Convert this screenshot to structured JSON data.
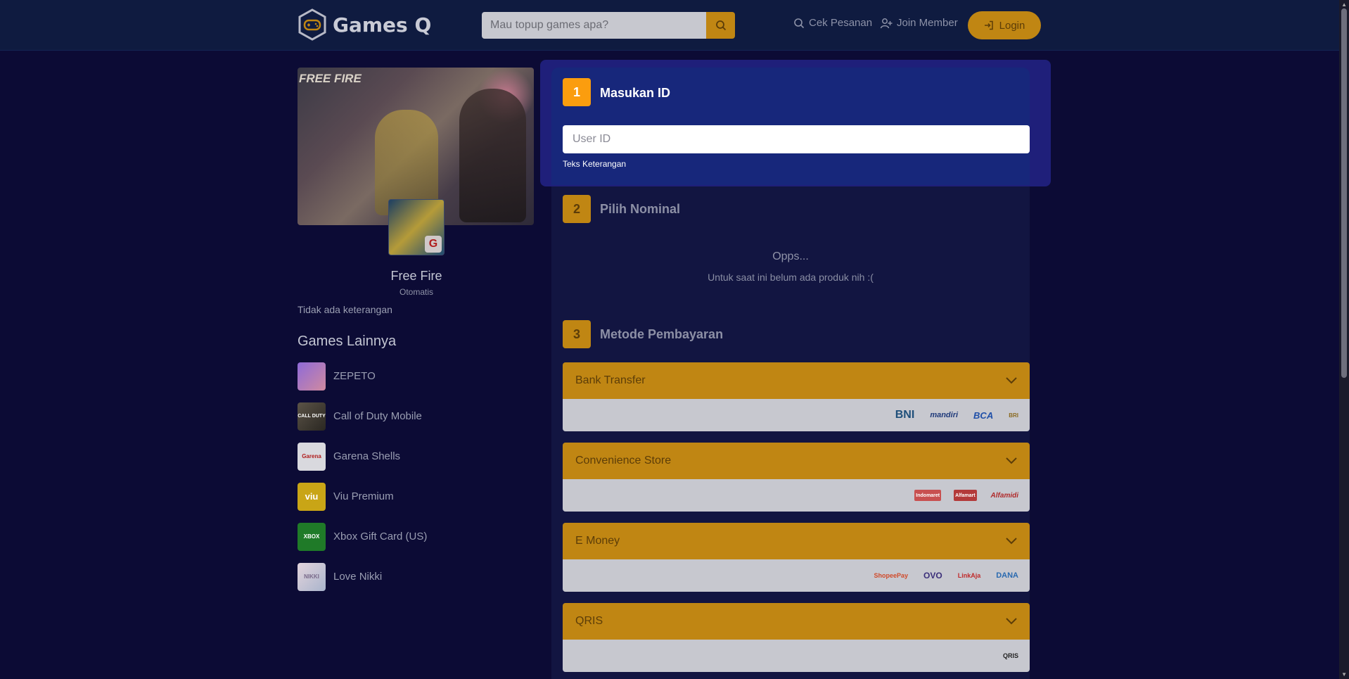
{
  "header": {
    "brand": "Games Q",
    "search_placeholder": "Mau topup games apa?",
    "nav_check_order": "Cek Pesanan",
    "nav_join": "Join Member",
    "login_label": "Login"
  },
  "game": {
    "banner_text": "FREE FIRE",
    "name": "Free Fire",
    "mode": "Otomatis",
    "description": "Tidak ada keterangan"
  },
  "others": {
    "title": "Games Lainnya",
    "items": [
      {
        "name": "ZEPETO",
        "thumb_text": "",
        "color": "#7b5cc9"
      },
      {
        "name": "Call of Duty Mobile",
        "thumb_text": "CALL DUTY",
        "color": "#3d3a35"
      },
      {
        "name": "Garena Shells",
        "thumb_text": "Garena",
        "color": "#d9d9de"
      },
      {
        "name": "Viu Premium",
        "thumb_text": "viu",
        "color": "#c9a516"
      },
      {
        "name": "Xbox Gift Card (US)",
        "thumb_text": "XBOX",
        "color": "#1f7a28"
      },
      {
        "name": "Love Nikki",
        "thumb_text": "NIKKI",
        "color": "#c9b9c4"
      }
    ]
  },
  "steps": {
    "step1": {
      "number": "1",
      "title": "Masukan ID",
      "input_placeholder": "User ID",
      "hint": "Teks Keterangan"
    },
    "step2": {
      "number": "2",
      "title": "Pilih Nominal",
      "empty_title": "Opps...",
      "empty_text": "Untuk saat ini belum ada produk nih :("
    },
    "step3": {
      "number": "3",
      "title": "Metode Pembayaran"
    }
  },
  "payments": [
    {
      "title": "Bank Transfer",
      "logos": [
        "BNI",
        "mandiri",
        "BCA",
        "BRI"
      ]
    },
    {
      "title": "Convenience Store",
      "logos": [
        "Indomaret",
        "Alfamart",
        "Alfamidi"
      ]
    },
    {
      "title": "E Money",
      "logos": [
        "ShopeePay",
        "OVO",
        "LinkAja",
        "DANA"
      ]
    },
    {
      "title": "QRIS",
      "logos": [
        "QRIS"
      ]
    }
  ],
  "colors": {
    "accent": "#fb9d0e",
    "accent_dim": "#c08613",
    "active_panel": "#17277b",
    "background": "#0c0b35"
  }
}
